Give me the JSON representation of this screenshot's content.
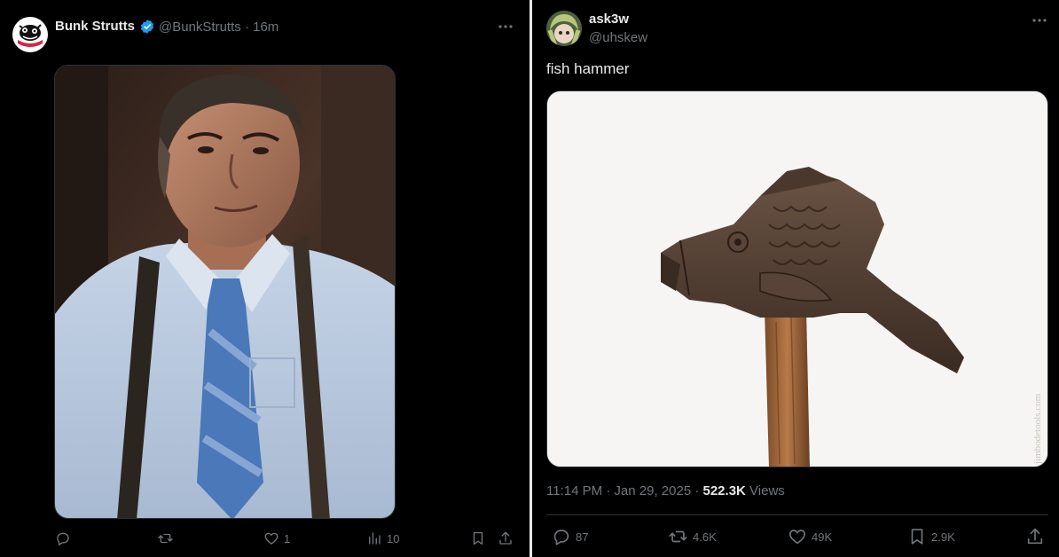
{
  "left_tweet": {
    "display_name": "Bunk Strutts",
    "handle": "@BunkStrutts",
    "separator": "·",
    "time_ago": "16m",
    "actions": {
      "reply_count": "",
      "repost_count": "",
      "like_count": "1",
      "views_count": "10"
    }
  },
  "right_tweet": {
    "display_name": "ask3w",
    "handle": "@uhskew",
    "text": "fish hammer",
    "image_watermark": "jimbodetools.com",
    "timestamp": "11:14 PM · Jan 29, 2025 · ",
    "views_count": "522.3K",
    "views_label": " Views",
    "actions": {
      "reply_count": "87",
      "repost_count": "4.6K",
      "like_count": "49K",
      "bookmark_count": "2.9K"
    }
  },
  "colors": {
    "text_primary": "#e7e9ea",
    "text_secondary": "#71767b",
    "verified_blue": "#1d9bf0",
    "divider": "#2f3336"
  }
}
